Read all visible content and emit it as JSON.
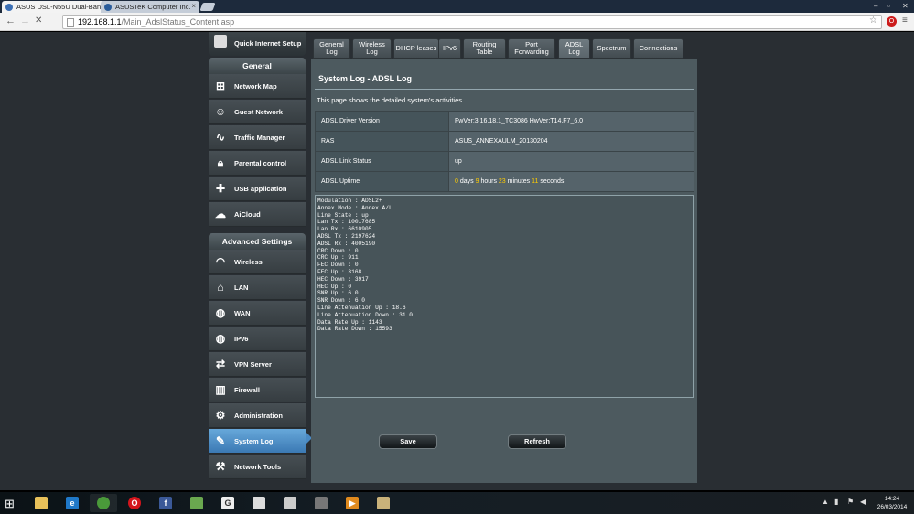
{
  "browser": {
    "tabs": [
      {
        "title": "ASUS DSL-N55U Dual-Ban",
        "active": true
      },
      {
        "title": "ASUSTeK Computer Inc.",
        "active": false
      }
    ],
    "url_host": "192.168.1.1",
    "url_path": "/Main_AdslStatus_Content.asp",
    "tab_close": "×"
  },
  "sidebar": {
    "quick_setup": "Quick Internet Setup",
    "general_heading": "General",
    "general_items": [
      {
        "label": "Network Map",
        "icon": "network-map-icon"
      },
      {
        "label": "Guest Network",
        "icon": "guest-network-icon"
      },
      {
        "label": "Traffic Manager",
        "icon": "traffic-manager-icon"
      },
      {
        "label": "Parental control",
        "icon": "lock-icon"
      },
      {
        "label": "USB application",
        "icon": "puzzle-icon"
      },
      {
        "label": "AiCloud",
        "icon": "cloud-icon"
      }
    ],
    "advanced_heading": "Advanced Settings",
    "advanced_items": [
      {
        "label": "Wireless",
        "icon": "wifi-icon"
      },
      {
        "label": "LAN",
        "icon": "home-icon"
      },
      {
        "label": "WAN",
        "icon": "globe-icon"
      },
      {
        "label": "IPv6",
        "icon": "ipv6-globe-icon"
      },
      {
        "label": "VPN Server",
        "icon": "vpn-icon"
      },
      {
        "label": "Firewall",
        "icon": "firewall-icon"
      },
      {
        "label": "Administration",
        "icon": "admin-icon"
      },
      {
        "label": "System Log",
        "icon": "system-log-icon",
        "selected": true
      },
      {
        "label": "Network Tools",
        "icon": "network-tools-icon"
      }
    ]
  },
  "tabs": [
    {
      "label": "General Log"
    },
    {
      "label": "Wireless Log"
    },
    {
      "label": "DHCP leases"
    },
    {
      "label": "IPv6"
    },
    {
      "label": "Routing Table"
    },
    {
      "label": "Port Forwarding"
    },
    {
      "label": "ADSL Log",
      "active": true
    },
    {
      "label": "Spectrum"
    },
    {
      "label": "Connections"
    }
  ],
  "panel": {
    "title": "System Log - ADSL Log",
    "description": "This page shows the detailed system's activities.",
    "rows": [
      {
        "label": "ADSL Driver Version",
        "value": "FwVer:3.16.18.1_TC3086 HwVer:T14.F7_6.0"
      },
      {
        "label": "RAS",
        "value": "ASUS_ANNEXAULM_20130204"
      },
      {
        "label": "ADSL Link Status",
        "value": "up"
      }
    ],
    "uptime": {
      "label": "ADSL Uptime",
      "days": "0",
      "days_unit": " days ",
      "hours": "9",
      "hours_unit": " hours ",
      "minutes": "23",
      "minutes_unit": " minutes ",
      "seconds": "11",
      "seconds_unit": " seconds"
    },
    "log_lines": [
      "Modulation : ADSL2+",
      "Annex Mode : Annex A/L",
      "Line State : up",
      "Lan Tx : 10017685",
      "Lan Rx : 6610905",
      "ADSL Tx : 2197624",
      "ADSL Rx : 4005190",
      "CRC Down : 0",
      "CRC Up : 911",
      "FEC Down : 0",
      "FEC Up : 3168",
      "HEC Down : 3917",
      "HEC Up : 0",
      "SNR Up : 6.0",
      "SNR Down : 6.0",
      "Line Attenuation Up : 18.6",
      "Line Attenuation Down : 31.0",
      "Data Rate Up : 1143",
      "Data Rate Down : 15593"
    ],
    "save_label": "Save",
    "refresh_label": "Refresh"
  },
  "taskbar": {
    "time": "14:24",
    "date": "26/03/2014"
  }
}
